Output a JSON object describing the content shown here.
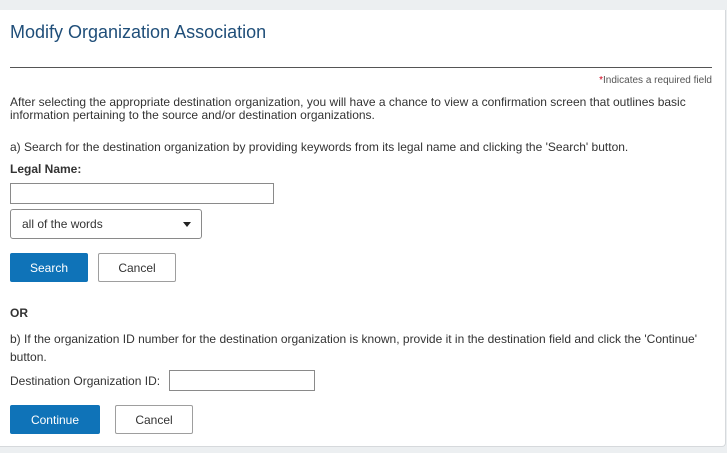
{
  "page": {
    "title": "Modify Organization Association",
    "required_star": "*",
    "required_note": "Indicates a required field",
    "intro": "After selecting the appropriate destination organization, you will have a chance to view a confirmation screen that outlines basic information pertaining to the source and/or destination organizations."
  },
  "search_section": {
    "instructions": "a) Search for the destination organization by providing keywords from its legal name and clicking the 'Search' button.",
    "legal_name_label": "Legal Name:",
    "legal_name_value": "",
    "match_selected": "all of the words",
    "search_button": "Search",
    "cancel_button": "Cancel"
  },
  "or_label": "OR",
  "id_section": {
    "instructions": "b) If the organization ID number for the destination organization is known, provide it in the destination field and click the 'Continue' button.",
    "dest_id_label": "Destination Organization ID:",
    "dest_id_value": "",
    "continue_button": "Continue",
    "cancel_button": "Cancel"
  },
  "colors": {
    "title": "#1f4e79",
    "primary_button": "#0f73b8",
    "required_star": "#d0021b"
  }
}
